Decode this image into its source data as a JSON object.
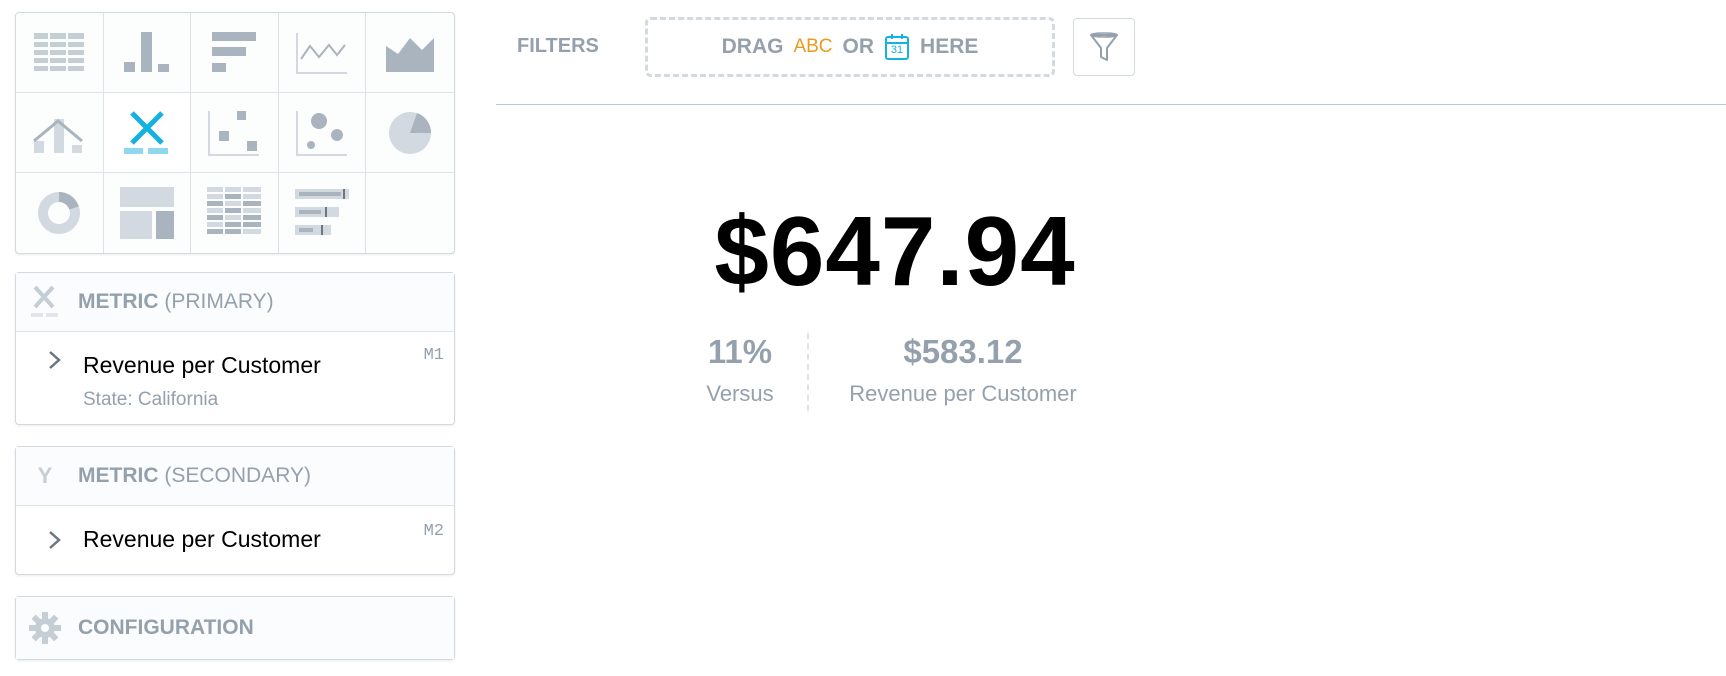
{
  "viz_types": [
    {
      "name": "table-icon",
      "active": false
    },
    {
      "name": "column-chart-icon",
      "active": false
    },
    {
      "name": "bar-chart-icon",
      "active": false
    },
    {
      "name": "line-chart-icon",
      "active": false
    },
    {
      "name": "area-chart-icon",
      "active": false
    },
    {
      "name": "combo-chart-icon",
      "active": false
    },
    {
      "name": "headline-icon",
      "active": true
    },
    {
      "name": "scatter-plot-icon",
      "active": false
    },
    {
      "name": "bubble-chart-icon",
      "active": false
    },
    {
      "name": "pie-chart-icon",
      "active": false
    },
    {
      "name": "donut-chart-icon",
      "active": false
    },
    {
      "name": "treemap-icon",
      "active": false
    },
    {
      "name": "heatmap-icon",
      "active": false
    },
    {
      "name": "bullet-chart-icon",
      "active": false
    },
    {
      "name": "empty",
      "active": false
    }
  ],
  "primary": {
    "title_bold": "METRIC",
    "title_rest": "(PRIMARY)",
    "item": {
      "name": "Revenue per Customer",
      "filter": "State: California",
      "code": "M1"
    }
  },
  "secondary": {
    "title_bold": "METRIC",
    "title_rest": "(SECONDARY)",
    "icon_letter": "Y",
    "item": {
      "name": "Revenue per Customer",
      "code": "M2"
    }
  },
  "configuration": {
    "title": "CONFIGURATION"
  },
  "filters": {
    "label": "FILTERS",
    "drag": "DRAG",
    "abc": "ABC",
    "or": "OR",
    "calendar_day": "31",
    "here": "HERE"
  },
  "headline": {
    "primary_value": "$647.94",
    "compare_percent": "11%",
    "compare_percent_label": "Versus",
    "secondary_value": "$583.12",
    "secondary_label": "Revenue per Customer"
  },
  "colors": {
    "accent": "#14b2e2",
    "muted": "#94a1ad",
    "border": "#d3d9e0",
    "orange": "#ea9a1d"
  }
}
